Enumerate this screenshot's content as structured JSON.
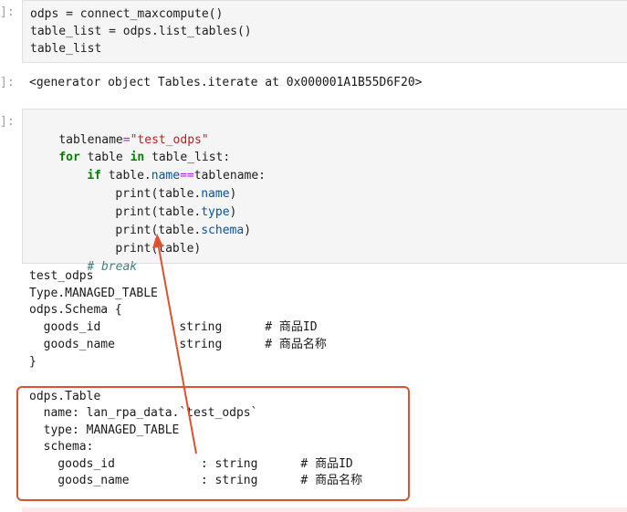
{
  "cell1": {
    "prompt": "]:",
    "lines": [
      "odps = connect_maxcompute()",
      "table_list = odps.list_tables()",
      "table_list"
    ]
  },
  "cell1_output": {
    "prompt": "]:",
    "text": "<generator object Tables.iterate at 0x000001A1B55D6F20>"
  },
  "cell2": {
    "prompt": "]:",
    "tokens": {
      "line1_var": "tablename",
      "line1_eq": "=",
      "line1_str": "\"test_odps\"",
      "line2_for": "for",
      "line2_mid": " table ",
      "line2_in": "in",
      "line2_rest": " table_list:",
      "line3_if": "if",
      "line3_a": " table.",
      "line3_name": "name",
      "line3_eq": "==",
      "line3_b": "tablename:",
      "line4_a": "print(table.",
      "line4_attr": "name",
      "line4_b": ")",
      "line5_a": "print(table.",
      "line5_attr": "type",
      "line5_b": ")",
      "line6_a": "print(table.",
      "line6_attr": "schema",
      "line6_b": ")",
      "line7": "print(table)",
      "line8_comment": "# break"
    }
  },
  "cell2_output": {
    "lines": [
      "test_odps",
      "Type.MANAGED_TABLE",
      "odps.Schema {",
      "  goods_id           string      # 商品ID",
      "  goods_name         string      # 商品名称",
      "}"
    ],
    "table_lines": [
      "odps.Table",
      "  name: lan_rpa_data.`test_odps`",
      "  type: MANAGED_TABLE",
      "  schema:",
      "    goods_id            : string      # 商品ID",
      "    goods_name          : string      # 商品名称"
    ]
  },
  "annotation": {
    "box_color": "#e0502f",
    "arrow_color": "#e0502f"
  }
}
